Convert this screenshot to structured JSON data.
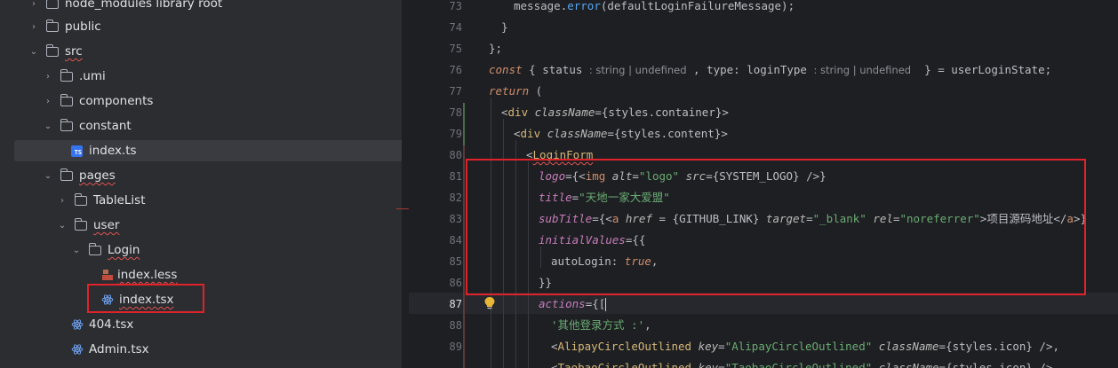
{
  "tree": {
    "items": [
      {
        "label": "node_modules  library root",
        "type": "folder",
        "expanded": false,
        "depth": 1
      },
      {
        "label": "public",
        "type": "folder",
        "expanded": false,
        "depth": 1
      },
      {
        "label": "src",
        "type": "folder",
        "expanded": true,
        "depth": 1
      },
      {
        "label": ".umi",
        "type": "folder",
        "expanded": false,
        "depth": 2
      },
      {
        "label": "components",
        "type": "folder",
        "expanded": false,
        "depth": 2
      },
      {
        "label": "constant",
        "type": "folder",
        "expanded": true,
        "depth": 2
      },
      {
        "label": "index.ts",
        "type": "ts",
        "depth": 3,
        "selected": true
      },
      {
        "label": "pages",
        "type": "folder",
        "expanded": true,
        "depth": 2
      },
      {
        "label": "TableList",
        "type": "folder",
        "expanded": false,
        "depth": 3
      },
      {
        "label": "user",
        "type": "folder",
        "expanded": true,
        "depth": 3
      },
      {
        "label": "Login",
        "type": "folder",
        "expanded": true,
        "depth": 4
      },
      {
        "label": "index.less",
        "type": "less",
        "depth": 5
      },
      {
        "label": "index.tsx",
        "type": "tsx",
        "depth": 5
      },
      {
        "label": "404.tsx",
        "type": "tsx",
        "depth": 3
      },
      {
        "label": "Admin.tsx",
        "type": "tsx",
        "depth": 3
      }
    ],
    "chevron_right": "›",
    "chevron_down": "⌄",
    "ts_badge": "TS"
  },
  "editor": {
    "line_numbers": [
      "73",
      "74",
      "75",
      "76",
      "77",
      "78",
      "79",
      "80",
      "81",
      "82",
      "83",
      "84",
      "85",
      "86",
      "87",
      "88",
      "89"
    ],
    "current_line": "87",
    "lines": {
      "l73": {
        "a": "message",
        "b": ".",
        "c": "error",
        "d": "(defaultLoginFailureMessage);"
      },
      "l74": {
        "a": "}"
      },
      "l75": {
        "a": "};"
      },
      "l76": {
        "kw": "const",
        "a": " { status ",
        "h1": ": string | undefined",
        "b": " , type: loginType ",
        "h2": ": string | undefined",
        "c": "  } = userLoginState;"
      },
      "l77": {
        "kw": "return",
        "a": " ("
      },
      "l78": {
        "lt": "<",
        "tag": "div",
        "attr": " className",
        "eq": "=",
        "val": "{styles.container}",
        "gt": ">"
      },
      "l79": {
        "lt": "<",
        "tag": "div",
        "attr": " className",
        "eq": "=",
        "val": "{styles.content}",
        "gt": ">"
      },
      "l80": {
        "lt": "<",
        "tag": "LoginForm"
      },
      "l81": {
        "attr": "logo",
        "a": "={",
        "lt": "<",
        "tag": "img",
        "attr2": " alt",
        "eq": "=",
        "str": "\"logo\"",
        "attr3": " src",
        "eq2": "=",
        "b": "{SYSTEM_LOGO}",
        "c": " />",
        "d": "}"
      },
      "l82": {
        "attr": "title",
        "eq": "=",
        "str": "\"天地一家大爱盟\""
      },
      "l83": {
        "attr": "subTitle",
        "a": "={",
        "lt": "<",
        "tag": "a",
        "attr2": " href",
        "eq": " = ",
        "b": "{GITHUB_LINK}",
        "attr3": " target",
        "eq2": "=",
        "str": "\"_blank\"",
        "attr4": " rel",
        "eq3": "=",
        "str2": "\"noreferrer\"",
        "c": ">项目源码地址",
        "lt2": "</",
        "tag2": "a",
        "d": ">}"
      },
      "l84": {
        "attr": "initialValues",
        "a": "={{"
      },
      "l85": {
        "prop": "autoLogin",
        "a": ": ",
        "kw": "true",
        "b": ","
      },
      "l86": {
        "a": "}}"
      },
      "l87": {
        "attr": "actions",
        "a": "={["
      },
      "l88": {
        "str": "'其他登录方式 :'",
        "a": ","
      },
      "l89": {
        "lt": "<",
        "tag": "AlipayCircleOutlined",
        "attr": " key",
        "eq": "=",
        "str": "\"AlipayCircleOutlined\"",
        "attr2": " className",
        "eq2": "=",
        "b": "{styles.icon}",
        "c": " />,"
      },
      "l90": {
        "lt": "<",
        "tag": "TaobaoCircleOutlined",
        "attr": " key",
        "eq": "=",
        "str": "\"TaobaoCircleOutlined\"",
        "attr2": " className",
        "eq2": "=",
        "b": "{styles.icon}",
        "c": " />"
      }
    }
  },
  "colors": {
    "annotation_box": "#e0232b",
    "accent": "#3574f0"
  }
}
